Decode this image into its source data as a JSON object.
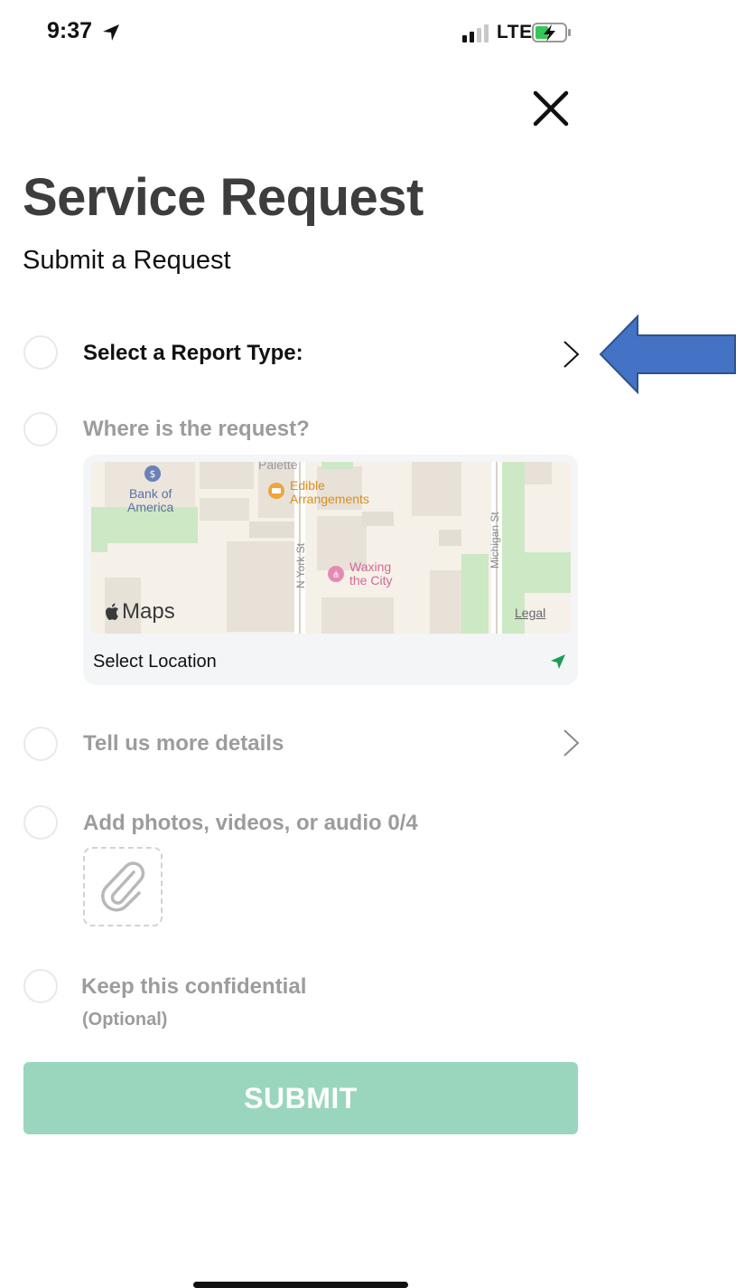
{
  "status_bar": {
    "time": "9:37",
    "network": "LTE"
  },
  "header": {
    "title": "Service Request",
    "subtitle": "Submit a Request"
  },
  "steps": {
    "report_type": "Select a Report Type:",
    "location": "Where is the request?",
    "details": "Tell us more details",
    "media": "Add photos, videos, or audio 0/4",
    "confidential": "Keep this confidential",
    "confidential_hint": "(Optional)"
  },
  "map": {
    "place_1": "Palette",
    "place_2a": "Bank of",
    "place_2b": "America",
    "place_3a": "Edible",
    "place_3b": "Arrangements",
    "place_4a": "Waxing",
    "place_4b": "the City",
    "street_1": "N York St",
    "street_2": "Michigan St",
    "brand": "Maps",
    "legal": "Legal",
    "select_location": "Select Location"
  },
  "submit_label": "SUBMIT",
  "colors": {
    "accent_green": "#99d6bd",
    "locate_green": "#1f9a55",
    "annotation_blue": "#4472c4"
  },
  "icons": [
    "location-arrow-icon",
    "signal-icon",
    "battery-charging-icon",
    "close-icon",
    "chevron-right-icon",
    "paperclip-icon",
    "locate-icon",
    "apple-logo-icon"
  ]
}
